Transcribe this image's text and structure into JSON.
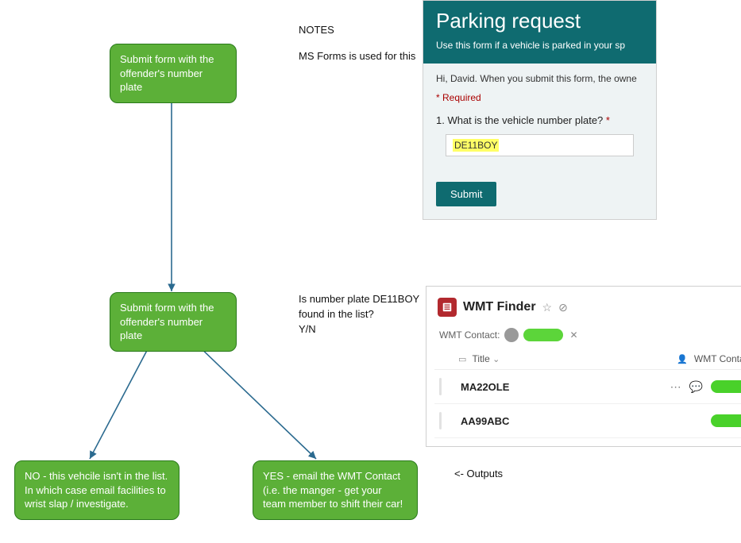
{
  "notes": {
    "heading": "NOTES",
    "line1": "MS Forms is used for this",
    "check_q": "Is number plate DE11BOY found in the list?",
    "check_yn": "Y/N",
    "outputs": "<- Outputs"
  },
  "flow": {
    "step1": "Submit form with the offender's number plate",
    "step2": "Submit form with the offender's number plate",
    "no": "NO - this vehcile isn't in the list.  In which case email facilities to wrist slap / investigate.",
    "yes": "YES - email the WMT Contact (i.e. the manger - get your team member to shift their car!"
  },
  "msform": {
    "title": "Parking request",
    "subtitle": "Use this form if a vehicle is parked in your sp",
    "greeting": "Hi, David. When you submit this form, the owne",
    "required": "* Required",
    "question": "1. What is the vehicle number plate? ",
    "answer": "DE11BOY",
    "submit": "Submit"
  },
  "sp": {
    "title": "WMT Finder",
    "filter_label": "WMT Contact:",
    "col_title": "Title",
    "col_contact": "WMT Contact",
    "rows": [
      {
        "title": "MA22OLE"
      },
      {
        "title": "AA99ABC"
      }
    ]
  }
}
